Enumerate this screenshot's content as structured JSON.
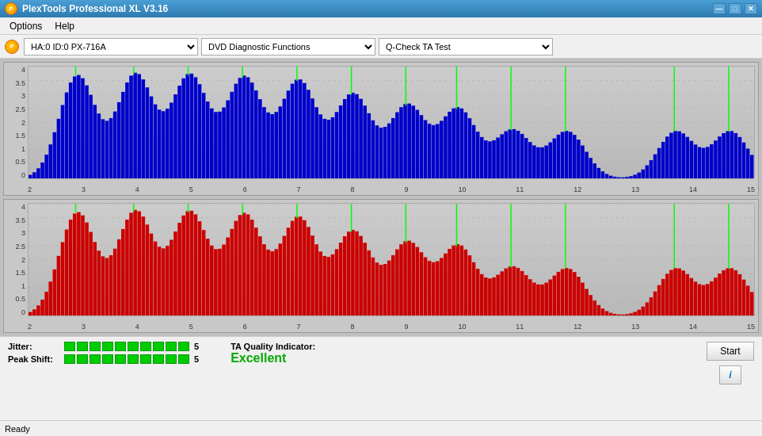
{
  "titlebar": {
    "title": "PlexTools Professional XL V3.16",
    "icon": "P",
    "min_btn": "—",
    "max_btn": "□",
    "close_btn": "✕"
  },
  "menu": {
    "items": [
      "Options",
      "Help"
    ]
  },
  "toolbar": {
    "drive": "HA:0 ID:0 PX-716A",
    "function": "DVD Diagnostic Functions",
    "test": "Q-Check TA Test"
  },
  "charts": {
    "y_labels": [
      "4",
      "3.5",
      "3",
      "2.5",
      "2",
      "1.5",
      "1",
      "0.5",
      "0"
    ],
    "x_labels": [
      "2",
      "3",
      "4",
      "5",
      "6",
      "7",
      "8",
      "9",
      "10",
      "11",
      "12",
      "13",
      "14",
      "15"
    ]
  },
  "metrics": {
    "jitter_label": "Jitter:",
    "jitter_value": "5",
    "jitter_bars": 10,
    "peak_shift_label": "Peak Shift:",
    "peak_shift_value": "5",
    "peak_shift_bars": 10,
    "ta_quality_label": "TA Quality Indicator:",
    "ta_quality_value": "Excellent"
  },
  "buttons": {
    "start": "Start",
    "info": "i"
  },
  "statusbar": {
    "text": "Ready"
  }
}
